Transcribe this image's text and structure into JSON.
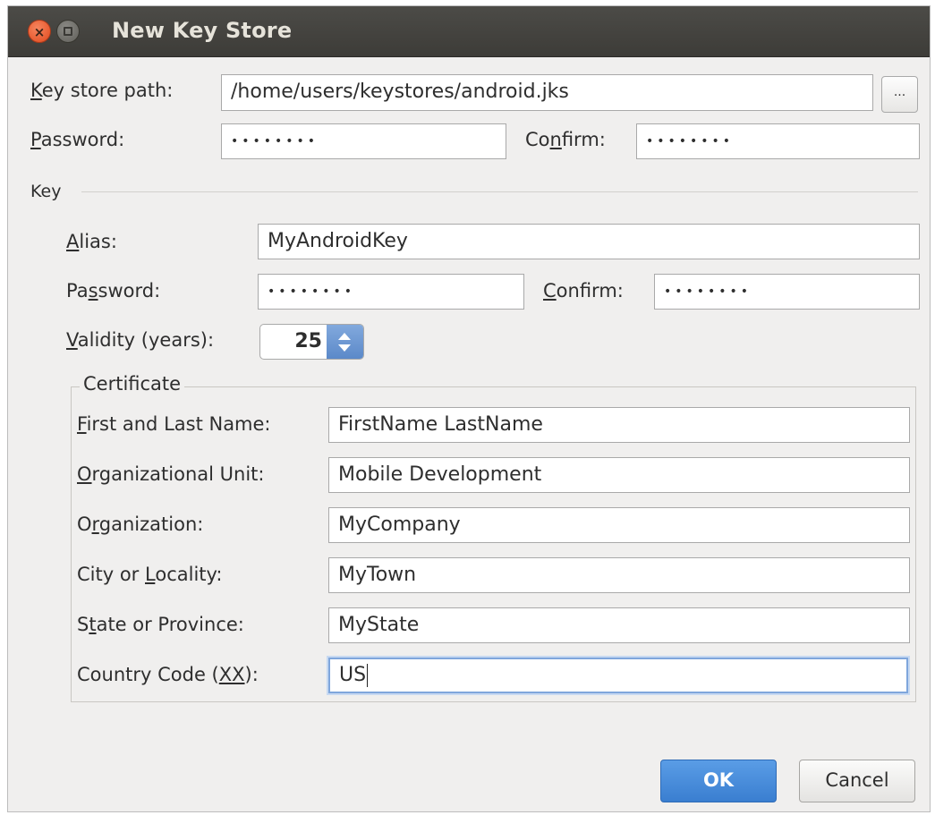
{
  "window": {
    "title": "New Key Store",
    "close_glyph": "×"
  },
  "keystore": {
    "path_label_first": "K",
    "path_label_rest": "ey store path:",
    "path_value": "/home/users/keystores/android.jks",
    "browse_label": "...",
    "password_label_first": "P",
    "password_label_rest": "assword:",
    "password_value": "••••••••",
    "confirm_label_pre": "Co",
    "confirm_label_u": "n",
    "confirm_label_post": "firm:",
    "confirm_value": "••••••••"
  },
  "key": {
    "section_label": "Key",
    "alias_label_first": "A",
    "alias_label_rest": "lias:",
    "alias_value": "MyAndroidKey",
    "password_label_pre": "Pa",
    "password_label_u": "s",
    "password_label_post": "sword:",
    "password_value": "••••••••",
    "confirm_label_first": "C",
    "confirm_label_rest": "onfirm:",
    "confirm_value": "••••••••",
    "validity_label_first": "V",
    "validity_label_rest": "alidity (years):",
    "validity_value": "25"
  },
  "certificate": {
    "legend": "Certificate",
    "first_last_label_first": "F",
    "first_last_label_rest": "irst and Last Name:",
    "first_last_value": "FirstName LastName",
    "org_unit_label_first": "O",
    "org_unit_label_rest": "rganizational Unit:",
    "org_unit_value": "Mobile Development",
    "org_label_pre": "O",
    "org_label_u": "r",
    "org_label_post": "ganization:",
    "org_value": "MyCompany",
    "city_label_pre": "City or ",
    "city_label_u": "L",
    "city_label_post": "ocality:",
    "city_value": "MyTown",
    "state_label_pre": "S",
    "state_label_u": "t",
    "state_label_post": "ate or Province:",
    "state_value": "MyState",
    "country_label_pre": "Country Code (",
    "country_label_u": "XX",
    "country_label_post": "):",
    "country_value": "US"
  },
  "buttons": {
    "ok": "OK",
    "cancel": "Cancel"
  },
  "colors": {
    "titlebar": "#3d3c38",
    "dialog_bg": "#f0efee",
    "primary_button": "#3a7ed0",
    "focus_ring": "#7fa6dc"
  }
}
